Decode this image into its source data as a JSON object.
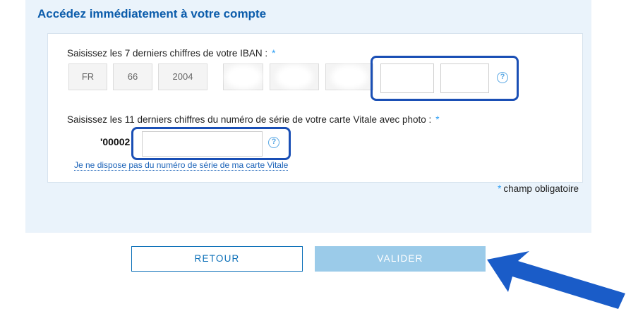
{
  "panel": {
    "title": "Accédez immédiatement à votre compte"
  },
  "iban": {
    "label": "Saisissez les 7 derniers chiffres de votre IBAN :",
    "required_mark": "*",
    "fixed_parts": [
      "FR",
      "66",
      "2004",
      "",
      "",
      ""
    ],
    "input_values": [
      "",
      ""
    ],
    "help_symbol": "?"
  },
  "vitale": {
    "label": "Saisissez les 11 derniers chiffres du numéro de série de votre carte Vitale avec photo :",
    "required_mark": "*",
    "prefix": "'00002",
    "input_value": "",
    "help_symbol": "?",
    "no_serial_link": "Je ne dispose pas du numéro de série de ma carte Vitale"
  },
  "required_note": {
    "star": "*",
    "text": "champ obligatoire"
  },
  "buttons": {
    "back": "RETOUR",
    "submit": "VALIDER"
  },
  "colors": {
    "accent": "#0b5cab",
    "highlight": "#1a4fb5",
    "submit_disabled": "#9bcbe9",
    "panel_bg": "#eaf3fb",
    "arrow": "#1a5cc8"
  },
  "icons": {
    "help": "help-circle-icon",
    "pointer": "arrow-icon"
  }
}
